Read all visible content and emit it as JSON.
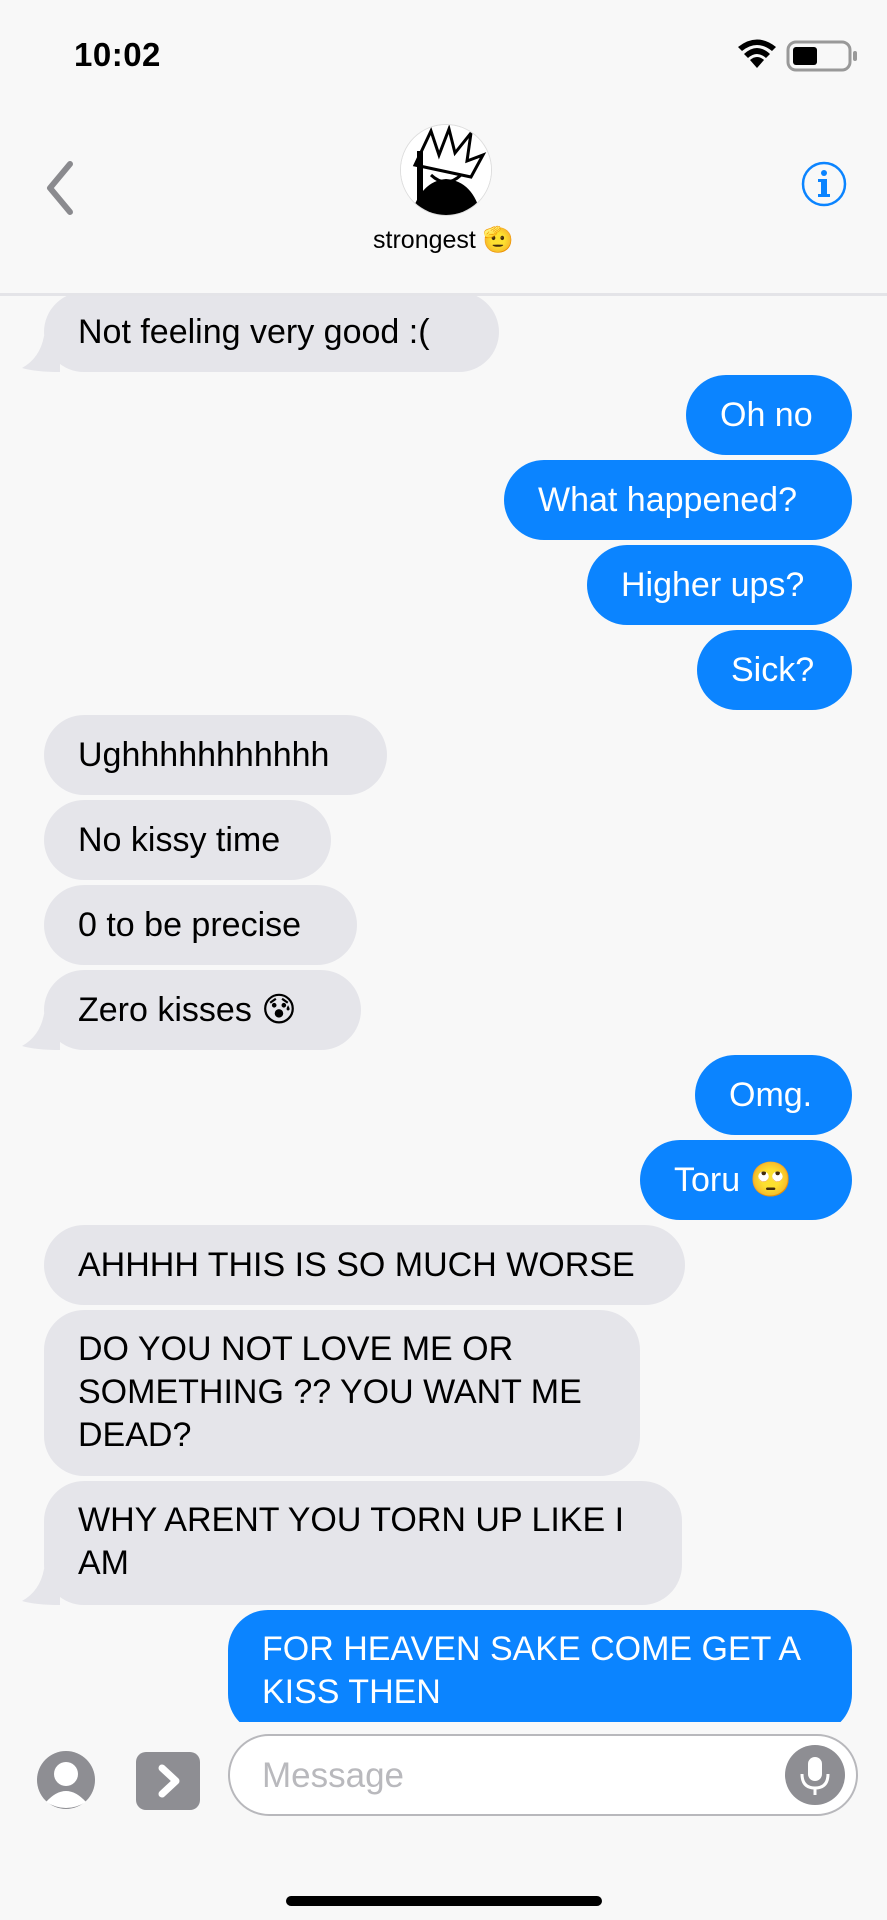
{
  "status_bar": {
    "time": "10:02"
  },
  "header": {
    "contact_name": "strongest",
    "contact_emoji": "🫡"
  },
  "messages": [
    {
      "text": "Not feeling very good :(",
      "direction": "incoming"
    },
    {
      "text": "Oh no",
      "direction": "outgoing"
    },
    {
      "text": "What happened?",
      "direction": "outgoing"
    },
    {
      "text": "Higher ups?",
      "direction": "outgoing"
    },
    {
      "text": "Sick?",
      "direction": "outgoing"
    },
    {
      "text": "Ughhhhhhhhhhh",
      "direction": "incoming"
    },
    {
      "text": "No kissy time",
      "direction": "incoming"
    },
    {
      "text": "0 to be precise",
      "direction": "incoming"
    },
    {
      "text": "Zero kisses 😰",
      "direction": "incoming"
    },
    {
      "text": "Omg.",
      "direction": "outgoing"
    },
    {
      "text": "Toru 🙄",
      "direction": "outgoing"
    },
    {
      "text": "AHHHH THIS IS SO MUCH WORSE",
      "direction": "incoming"
    },
    {
      "text": "DO YOU NOT LOVE ME OR SOMETHING ?? YOU WANT ME DEAD?",
      "direction": "incoming"
    },
    {
      "text": "WHY ARENT YOU TORN UP LIKE I AM",
      "direction": "incoming"
    },
    {
      "text": "FOR HEAVEN SAKE COME GET A KISS THEN",
      "direction": "outgoing"
    }
  ],
  "composer": {
    "placeholder": "Message"
  },
  "colors": {
    "outgoing": "#0b84ff",
    "incoming": "#e5e5ea",
    "accent": "#0b84ff"
  },
  "icons": [
    "back-chevron-icon",
    "info-icon",
    "contact-icon",
    "app-store-chevron-icon",
    "microphone-icon",
    "wifi-icon",
    "battery-icon"
  ]
}
